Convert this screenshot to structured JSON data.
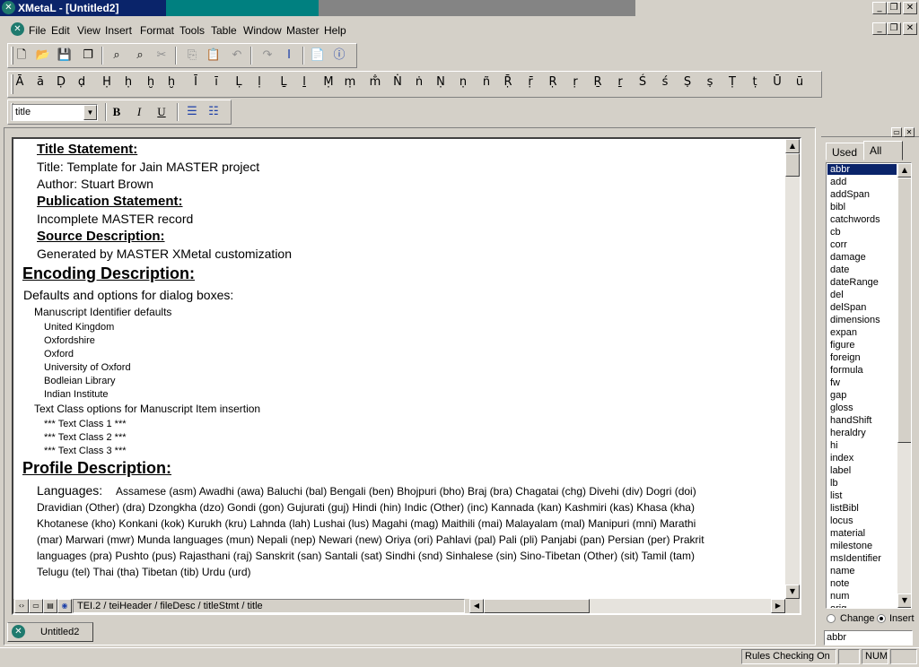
{
  "window": {
    "title": "XMetaL - [Untitled2]"
  },
  "menu": [
    "File",
    "Edit",
    "View",
    "Insert",
    "Format",
    "Tools",
    "Table",
    "Window",
    "Master",
    "Help"
  ],
  "char_toolbar": [
    "Ā",
    "ā",
    "Ḍ",
    "ḍ",
    "Ḥ",
    "ḥ",
    "ḫ",
    "ḫ",
    "Ī",
    "ī",
    "Ḷ",
    "ḷ",
    "Ḻ",
    "ḻ",
    "Ṃ",
    "ṃ",
    "m̐",
    "Ṅ",
    "ṅ",
    "Ṇ",
    "ṇ",
    "ñ",
    "Ṝ",
    "ṝ",
    "Ṛ",
    "ṛ",
    "Ṟ",
    "ṟ",
    "Ś",
    "ś",
    "Ṣ",
    "ṣ",
    "Ṭ",
    "ṭ",
    "Ū",
    "ū"
  ],
  "format_toolbar": {
    "style_value": "title",
    "bold": "B",
    "italic": "I",
    "underline": "U"
  },
  "document": {
    "title_stmt_heading": "Title Statement:",
    "title_line": "Title: Template for Jain MASTER project",
    "author_line": "Author: Stuart Brown",
    "pub_stmt_heading": "Publication Statement:",
    "pub_line": "Incomplete MASTER record",
    "source_heading": "Source Description:",
    "source_line": "Generated by MASTER XMetal customization",
    "encoding_heading": "Encoding Description:",
    "defaults_line": "Defaults and options for dialog boxes:",
    "ms_id_heading": "Manuscript Identifier defaults",
    "ms_id_items": [
      "United Kingdom",
      "Oxfordshire",
      "Oxford",
      "University of Oxford",
      "Bodleian Library",
      "Indian Institute"
    ],
    "text_class_heading": "Text Class options for Manuscript Item insertion",
    "text_class_items": [
      "*** Text Class 1 ***",
      "*** Text Class 2 ***",
      "*** Text Class 3 ***"
    ],
    "profile_heading": "Profile Description:",
    "languages_label": "Languages:",
    "languages_lines": [
      "Assamese (asm) Awadhi (awa) Baluchi (bal) Bengali (ben) Bhojpuri (bho) Braj (bra) Chagatai (chg) Divehi (div) Dogri (doi)",
      "Dravidian (Other) (dra) Dzongkha (dzo) Gondi (gon) Gujurati (guj) Hindi (hin) Indic (Other) (inc) Kannada (kan) Kashmiri (kas) Khasa (kha)",
      "Khotanese (kho) Konkani (kok) Kurukh (kru) Lahnda (lah) Lushai (lus) Magahi (mag) Maithili (mai) Malayalam (mal) Manipuri (mni) Marathi",
      "(mar) Marwari (mwr) Munda languages (mun) Nepali (nep) Newari (new) Oriya (ori) Pahlavi (pal) Pali (pli) Panjabi (pan) Persian (per) Prakrit",
      "languages (pra) Pushto (pus) Rajasthani (raj) Sanskrit (san) Santali (sat) Sindhi (snd) Sinhalese (sin) Sino-Tibetan (Other) (sit) Tamil (tam)",
      "Telugu (tel) Thai (tha) Tibetan (tib) Urdu (urd)"
    ]
  },
  "breadcrumb": "TEI.2 / teiHeader / fileDesc / titleStmt / title",
  "doc_tab": "Untitled2",
  "side_panel": {
    "tabs": [
      "Used",
      "All"
    ],
    "items": [
      "abbr",
      "add",
      "addSpan",
      "bibl",
      "catchwords",
      "cb",
      "corr",
      "damage",
      "date",
      "dateRange",
      "del",
      "delSpan",
      "dimensions",
      "expan",
      "figure",
      "foreign",
      "formula",
      "fw",
      "gap",
      "gloss",
      "handShift",
      "heraldry",
      "hi",
      "index",
      "label",
      "lb",
      "list",
      "listBibl",
      "locus",
      "material",
      "milestone",
      "msIdentifier",
      "name",
      "note",
      "num",
      "orig"
    ],
    "selected": "abbr",
    "radio_change": "Change",
    "radio_insert": "Insert",
    "filter_value": "abbr"
  },
  "status": {
    "rules": "Rules Checking On",
    "num": "NUM"
  }
}
